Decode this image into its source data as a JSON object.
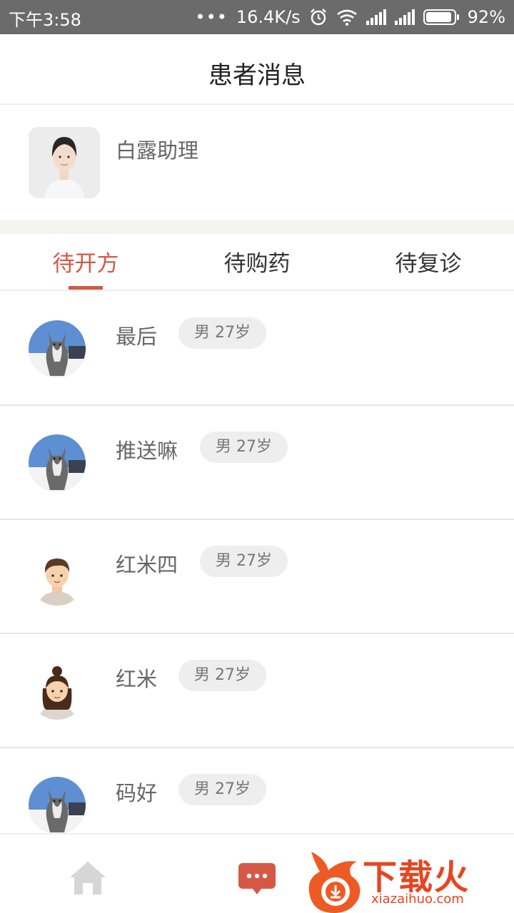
{
  "status_bar": {
    "time": "下午3:58",
    "net_speed": "16.4K/s",
    "battery": "92%",
    "battery_level": 0.92
  },
  "header": {
    "title": "患者消息"
  },
  "assistant": {
    "name": "白露助理"
  },
  "tabs": [
    {
      "label": "待开方",
      "active": true
    },
    {
      "label": "待购药",
      "active": false
    },
    {
      "label": "待复诊",
      "active": false
    }
  ],
  "patients": [
    {
      "name": "最后",
      "gender": "男",
      "age": "27岁",
      "tag": "男  27岁",
      "avatar": "husky-avatar"
    },
    {
      "name": "推送嘛",
      "gender": "男",
      "age": "27岁",
      "tag": "男  27岁",
      "avatar": "husky-avatar"
    },
    {
      "name": "红米四",
      "gender": "男",
      "age": "27岁",
      "tag": "男  27岁",
      "avatar": "boy-cartoon-avatar"
    },
    {
      "name": "红米",
      "gender": "男",
      "age": "27岁",
      "tag": "男  27岁",
      "avatar": "girl-cartoon-avatar"
    },
    {
      "name": "码好",
      "gender": "男",
      "age": "27岁",
      "tag": "男  27岁",
      "avatar": "husky-avatar"
    }
  ],
  "bottom_nav": {
    "items": [
      {
        "icon": "home-icon",
        "active": false
      },
      {
        "icon": "message-icon",
        "active": true
      }
    ]
  },
  "watermark": {
    "text": "下载火",
    "url": "xiazaihuo.com"
  },
  "colors": {
    "accent": "#d55846",
    "tag_bg": "#eeeeee",
    "status_bar": "#6b6b6b"
  }
}
